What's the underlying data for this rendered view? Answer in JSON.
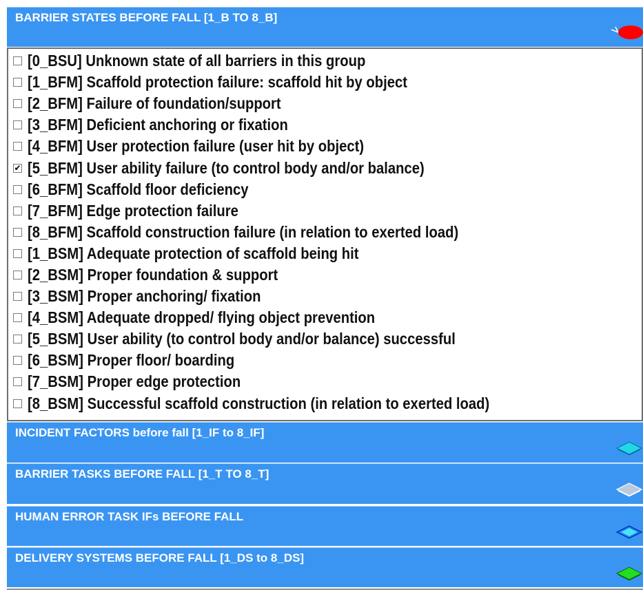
{
  "sections": [
    {
      "title": "BARRIER STATES BEFORE FALL [1_B TO 8_B]",
      "icon": "red-oval-icon",
      "color": "#ff0000"
    },
    {
      "title": "INCIDENT FACTORS before fall [1_IF to 8_IF]",
      "icon": "cyan-diamond-icon",
      "color": "#20d7e8"
    },
    {
      "title": "BARRIER TASKS BEFORE  FALL [1_T TO 8_T]",
      "icon": "gray-diamond-icon",
      "color": "#b9c9e0"
    },
    {
      "title": "HUMAN ERROR TASK IFs BEFORE FALL",
      "icon": "blue-diamond-icon",
      "color": "#1e78ff"
    },
    {
      "title": "DELIVERY SYSTEMS  BEFORE FALL [1_DS to 8_DS]",
      "icon": "green-diamond-icon",
      "color": "#22dd22"
    }
  ],
  "items": [
    {
      "label": "[0_BSU] Unknown state of all barriers in this group",
      "checked": false
    },
    {
      "label": "[1_BFM] Scaffold protection failure: scaffold hit by object",
      "checked": false
    },
    {
      "label": "[2_BFM] Failure of foundation/support",
      "checked": false
    },
    {
      "label": "[3_BFM] Deficient anchoring or fixation",
      "checked": false
    },
    {
      "label": "[4_BFM] User protection failure (user hit by object)",
      "checked": false
    },
    {
      "label": "[5_BFM] User ability failure (to control body and/or balance)",
      "checked": true
    },
    {
      "label": "[6_BFM] Scaffold floor deficiency",
      "checked": false
    },
    {
      "label": "[7_BFM] Edge protection failure",
      "checked": false
    },
    {
      "label": "[8_BFM] Scaffold construction failure (in relation to exerted load)",
      "checked": false
    },
    {
      "label": "[1_BSM] Adequate protection of scaffold being hit",
      "checked": false
    },
    {
      "label": "[2_BSM] Proper foundation & support",
      "checked": false
    },
    {
      "label": "[3_BSM] Proper anchoring/ fixation",
      "checked": false
    },
    {
      "label": "[4_BSM] Adequate dropped/ flying object prevention",
      "checked": false
    },
    {
      "label": "[5_BSM] User ability (to control body and/or balance) successful",
      "checked": false
    },
    {
      "label": "[6_BSM] Proper floor/ boarding",
      "checked": false
    },
    {
      "label": "[7_BSM] Proper edge protection",
      "checked": false
    },
    {
      "label": "[8_BSM] Successful scaffold construction (in relation to exerted load)",
      "checked": false
    }
  ]
}
